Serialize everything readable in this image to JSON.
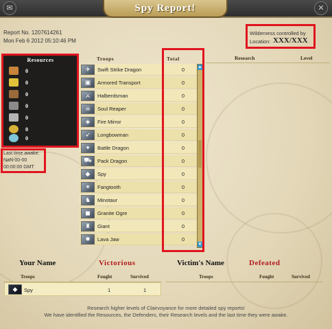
{
  "header": {
    "title": "Spy Report!",
    "left_icon": "scroll-icon",
    "close_icon": "close-icon"
  },
  "report": {
    "number_line": "Report No. 1207614261",
    "date_line": "Mon Feb 6 2012 05:10:46 PM"
  },
  "location": {
    "controlled_line": "Wilderness controlled by",
    "location_label": "Location:",
    "location_value": "XXX/XXX"
  },
  "resources": {
    "header": "Resources",
    "items": [
      {
        "icon": "food-icon",
        "color": "#c8843a",
        "value": "0"
      },
      {
        "icon": "gold-icon",
        "color": "#e2c23b",
        "value": "0"
      },
      {
        "icon": "wood-icon",
        "color": "#9b6a3a",
        "value": "0"
      },
      {
        "icon": "ore-icon",
        "color": "#8b8b8b",
        "value": "0"
      },
      {
        "icon": "stone-icon",
        "color": "#b5b5b5",
        "value": "0"
      },
      {
        "icon": "aetherstone-icon",
        "color": "#d8b13a",
        "value": "0"
      },
      {
        "icon": "blue-energy-icon",
        "color": "#7ec6d8",
        "value": "0"
      }
    ]
  },
  "last_awake": {
    "label": "Last time awake:",
    "date": "NaN-00-00",
    "time": "00:00:00 GMT"
  },
  "troops_table": {
    "col_troops": "Troops",
    "col_total": "Total",
    "rows": [
      {
        "name": "Swift Strike Dragon",
        "total": "0",
        "icon": "swift-strike-dragon-icon"
      },
      {
        "name": "Armored Transport",
        "total": "0",
        "icon": "armored-transport-icon"
      },
      {
        "name": "Halberdsman",
        "total": "0",
        "icon": "halberdsman-icon"
      },
      {
        "name": "Soul Reaper",
        "total": "0",
        "icon": "soul-reaper-icon"
      },
      {
        "name": "Fire Mirror",
        "total": "0",
        "icon": "fire-mirror-icon"
      },
      {
        "name": "Longbowman",
        "total": "0",
        "icon": "longbowman-icon"
      },
      {
        "name": "Battle Dragon",
        "total": "0",
        "icon": "battle-dragon-icon"
      },
      {
        "name": "Pack Dragon",
        "total": "0",
        "icon": "pack-dragon-icon"
      },
      {
        "name": "Spy",
        "total": "0",
        "icon": "spy-icon"
      },
      {
        "name": "Fangtooth",
        "total": "0",
        "icon": "fangtooth-icon"
      },
      {
        "name": "Minotaur",
        "total": "0",
        "icon": "minotaur-icon"
      },
      {
        "name": "Granite Ogre",
        "total": "0",
        "icon": "granite-ogre-icon"
      },
      {
        "name": "Giant",
        "total": "0",
        "icon": "giant-icon"
      },
      {
        "name": "Lava Jaw",
        "total": "0",
        "icon": "lava-jaw-icon"
      }
    ]
  },
  "research_table": {
    "col_research": "Research",
    "col_level": "Level"
  },
  "attacker": {
    "name": "Your Name",
    "status": "Victorious",
    "col_troops": "Troops",
    "col_fought": "Fought",
    "col_survived": "Survived",
    "rows": [
      {
        "name": "Spy",
        "fought": "1",
        "survived": "1",
        "icon": "spy-icon"
      }
    ]
  },
  "defender": {
    "name": "Victim's Name",
    "status": "Defeated",
    "col_troops": "Troops",
    "col_fought": "Fought",
    "col_survived": "Survived"
  },
  "footer": {
    "line1": "Research higher levels of Clairvoyance for more detailed spy reports!",
    "line2": "We have identified the Resources, the Defenders, their Research levels and the last time they were awake."
  },
  "colors": {
    "highlight_box": "#e0141e",
    "status_red": "#b01a1a",
    "scroll_arrow": "#3a9cc9"
  }
}
